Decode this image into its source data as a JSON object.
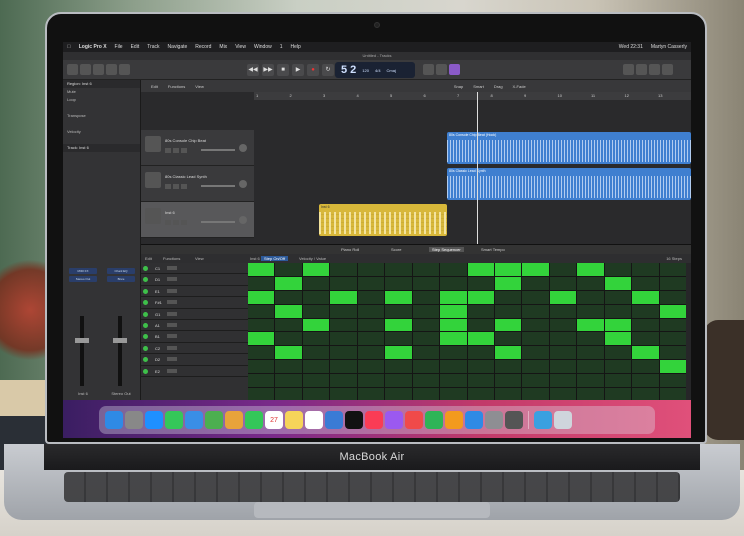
{
  "menubar": {
    "items": [
      "Logic Pro X",
      "File",
      "Edit",
      "Track",
      "Navigate",
      "Record",
      "Mix",
      "View",
      "Window",
      "1",
      "Help"
    ],
    "clock": "Wed 22:31",
    "user": "Martyn Casserly"
  },
  "window_title": "Untitled - Tracks",
  "lcd": {
    "position": "5 2",
    "tempo": "120",
    "sig": "4/4",
    "key": "Cmaj"
  },
  "inspector": {
    "region_label": "Region: Inst 6",
    "rows": [
      "Mute",
      "Loop",
      "",
      "Transpose",
      "",
      "Velocity",
      ""
    ],
    "track_label": "Track: Inst 6",
    "slot_a": "MIDI FX",
    "slot_b": "Chanl EQ",
    "insert": "Stereo Out",
    "left_name": "Inst 6",
    "right_name": "Stereo Out",
    "bnce": "Bnce"
  },
  "tracks": {
    "header": [
      "Edit",
      "Functions",
      "View"
    ],
    "right_header": [
      "Snap",
      "Smart",
      "Drag",
      "X-Fade"
    ],
    "ruler": [
      "1",
      "2",
      "3",
      "4",
      "5",
      "6",
      "7",
      "8",
      "9",
      "10",
      "11",
      "12",
      "13"
    ],
    "rows": [
      {
        "name": "80s Console Chip Beat"
      },
      {
        "name": "80s Classic Lead Synth"
      },
      {
        "name": "Inst 6"
      }
    ],
    "regions": {
      "audio1": "80s Console Chip Beat (Hook)",
      "audio2": "80s Classic Lead Synth",
      "midi": "Inst 6"
    }
  },
  "editor": {
    "tabs": [
      "Piano Roll",
      "Score",
      "Step Sequencer",
      "Smart Tempo"
    ],
    "active_tab": "Step Sequencer",
    "sub": [
      "Edit",
      "Functions",
      "View"
    ],
    "mode": "Step On/Off",
    "mode2": "Velocity / Value",
    "pattern_label": "Inst 6",
    "steps_label": "16 Steps",
    "rows": [
      {
        "note": "C1"
      },
      {
        "note": "D1"
      },
      {
        "note": "E1"
      },
      {
        "note": "F#1"
      },
      {
        "note": "G1"
      },
      {
        "note": "A1"
      },
      {
        "note": "B1"
      },
      {
        "note": "C2"
      },
      {
        "note": "D2"
      },
      {
        "note": "E2"
      }
    ],
    "steps": [
      [
        1,
        0,
        1,
        0,
        0,
        0,
        0,
        0,
        1,
        1,
        1,
        0,
        1,
        0,
        0,
        0
      ],
      [
        0,
        1,
        0,
        0,
        0,
        0,
        0,
        0,
        0,
        1,
        0,
        0,
        0,
        1,
        0,
        0
      ],
      [
        1,
        0,
        0,
        1,
        0,
        1,
        0,
        1,
        1,
        0,
        0,
        1,
        0,
        0,
        1,
        0
      ],
      [
        0,
        1,
        0,
        0,
        0,
        0,
        0,
        1,
        0,
        0,
        0,
        0,
        0,
        0,
        0,
        1
      ],
      [
        0,
        0,
        1,
        0,
        0,
        1,
        0,
        1,
        0,
        1,
        0,
        0,
        1,
        1,
        0,
        0
      ],
      [
        1,
        0,
        0,
        0,
        0,
        0,
        0,
        1,
        1,
        0,
        0,
        0,
        0,
        1,
        0,
        0
      ],
      [
        0,
        1,
        0,
        0,
        0,
        1,
        0,
        0,
        0,
        1,
        0,
        0,
        0,
        0,
        1,
        0
      ],
      [
        0,
        0,
        0,
        0,
        0,
        0,
        0,
        0,
        0,
        0,
        0,
        0,
        0,
        0,
        0,
        1
      ],
      [
        0,
        0,
        0,
        0,
        0,
        0,
        0,
        0,
        0,
        0,
        0,
        0,
        0,
        0,
        0,
        0
      ],
      [
        0,
        0,
        0,
        0,
        0,
        0,
        0,
        0,
        0,
        0,
        0,
        0,
        0,
        0,
        0,
        0
      ]
    ]
  },
  "laptop": {
    "brand": "MacBook Air"
  },
  "dock_icons": [
    "finder-icon",
    "launchpad-icon",
    "safari-icon",
    "messages-icon",
    "mail-icon",
    "maps-icon",
    "photos-icon",
    "facetime-icon",
    "calendar-icon",
    "notes-icon",
    "reminders-icon",
    "keynote-icon",
    "tv-icon",
    "music-icon",
    "podcasts-icon",
    "news-icon",
    "numbers-icon",
    "pages-icon",
    "appstore-icon",
    "settings-icon",
    "logic-icon",
    "folder-icon",
    "trash-icon"
  ],
  "calendar_day": "27"
}
